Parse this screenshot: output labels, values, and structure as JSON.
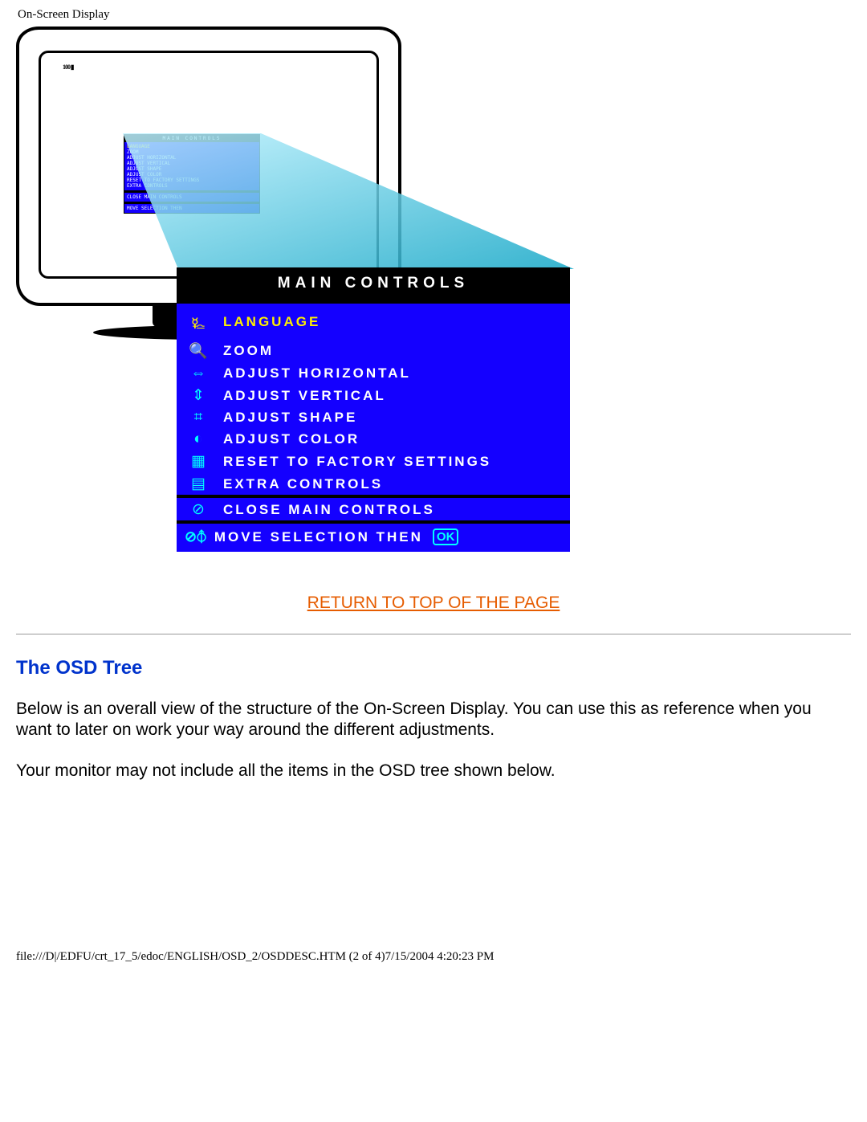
{
  "header": {
    "title": "On-Screen Display"
  },
  "monitor_badge": "100 ▮",
  "osd": {
    "title": "MAIN CONTROLS",
    "items": [
      {
        "icon": "globe-icon",
        "glyph": "🜐",
        "label": "LANGUAGE",
        "highlight": true
      },
      {
        "icon": "zoom-icon",
        "glyph": "🔍",
        "label": "ZOOM",
        "highlight": false
      },
      {
        "icon": "horiz-icon",
        "glyph": "⇔",
        "label": "ADJUST HORIZONTAL",
        "highlight": false
      },
      {
        "icon": "vert-icon",
        "glyph": "⇕",
        "label": "ADJUST VERTICAL",
        "highlight": false
      },
      {
        "icon": "shape-icon",
        "glyph": "⌗",
        "label": "ADJUST SHAPE",
        "highlight": false
      },
      {
        "icon": "color-icon",
        "glyph": "◐",
        "label": "ADJUST COLOR",
        "highlight": false
      },
      {
        "icon": "reset-icon",
        "glyph": "▦",
        "label": "RESET TO FACTORY SETTINGS",
        "highlight": false
      },
      {
        "icon": "extra-icon",
        "glyph": "▤",
        "label": "EXTRA CONTROLS",
        "highlight": false
      }
    ],
    "close": {
      "icon": "down-icon",
      "glyph": "⊘",
      "label": "CLOSE MAIN CONTROLS"
    },
    "footer": {
      "symbols": "⊘⦽",
      "label": "MOVE SELECTION THEN",
      "ok": "OK"
    }
  },
  "link": {
    "return_top": "RETURN TO TOP OF THE PAGE"
  },
  "section": {
    "heading": "The OSD Tree",
    "p1": "Below is an overall view of the structure of the On-Screen Display. You can use this as reference when you want to later on work your way around the different adjustments.",
    "p2": "Your monitor may not include all the items in the OSD tree shown below."
  },
  "footer": {
    "path": "file:///D|/EDFU/crt_17_5/edoc/ENGLISH/OSD_2/OSDDESC.HTM (2 of 4)7/15/2004 4:20:23 PM"
  }
}
